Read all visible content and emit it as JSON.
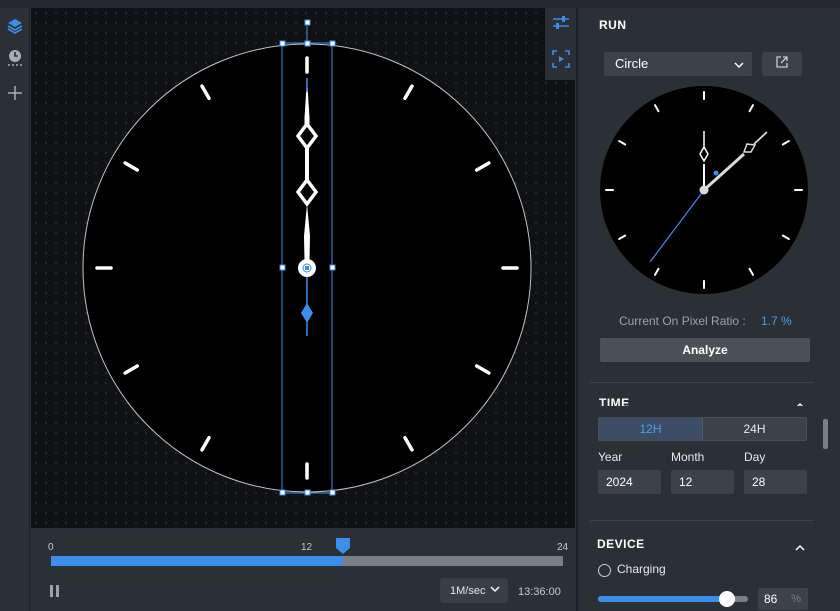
{
  "timeline": {
    "start_label": "0",
    "mid_label": "12",
    "end_label": "24",
    "progress": 0.57,
    "speed": "1M/sec",
    "current_time": "13:36:00"
  },
  "panel": {
    "run_title": "RUN",
    "shape_select": "Circle",
    "ratio_label": "Current On Pixel Ratio :",
    "ratio_value": "1.7 %",
    "analyze_label": "Analyze",
    "time_title": "TIME",
    "mode_12h": "12H",
    "mode_24h": "24H",
    "year_label": "Year",
    "month_label": "Month",
    "day_label": "Day",
    "year_value": "2024",
    "month_value": "12",
    "day_value": "28",
    "device_title": "DEVICE",
    "charging_label": "Charging",
    "battery_value": "86",
    "battery_unit": "%",
    "battery_level": 0.86
  },
  "colors": {
    "accent": "#3b8eea",
    "panel_bg": "#2b2f36",
    "canvas_bg": "#101114"
  },
  "icons": [
    "layers-icon",
    "history-icon",
    "plus-icon",
    "sliders-icon",
    "preview-icon",
    "external-link-icon",
    "chevron-down-icon",
    "chevron-up-icon",
    "pause-icon"
  ]
}
